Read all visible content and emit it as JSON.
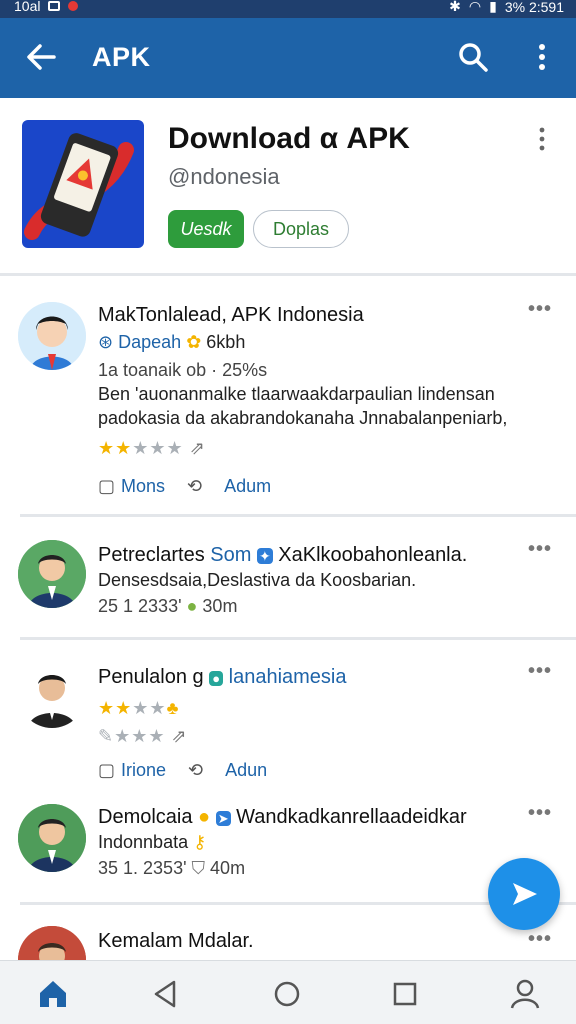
{
  "status_bar": {
    "time_left": "10al",
    "right_text": "3% 2:591"
  },
  "app_bar": {
    "title": "APK"
  },
  "header": {
    "app_title": "Download α APK",
    "app_subtitle": "@ndonesia",
    "primary_button": "Uesdk",
    "secondary_button": "Doplas"
  },
  "posts": [
    {
      "name": "MakTonlalead, APK Indonesia",
      "handle": "Dapeah",
      "handle_extra": "6kbh",
      "meta": "1a toanaik ob · 25%s",
      "text_line1": "Ben 'auonanmalke tlaarwaakdarpaulian lindensan",
      "text_line2": "padokasia da akabrandokanaha Jnnabalanpeniarb,",
      "action_more": "Mons",
      "action_add": "Adum"
    },
    {
      "name": "Petreclartes",
      "name_tag": "Som",
      "name_extra": "XaKlkoobahonleanla.",
      "text_line1": "Densesdsaia,Deslastiva da Koosbarian.",
      "meta": "25 1 2333'",
      "meta_extra": "30m"
    },
    {
      "name": "Penulalon",
      "name_tag": "g",
      "name_extra": "lanahiamesia",
      "action_more": "Irione",
      "action_add": "Adun"
    },
    {
      "name": "Demolcaia",
      "name_extra": "Wandkadkanrellaadeidkar",
      "text_line1": "Indonnbata",
      "meta": "35 1. 2353'",
      "meta_extra": "40m"
    },
    {
      "name": "Kemalam Mdalar."
    }
  ],
  "colors": {
    "app_bar": "#1e63a8",
    "status_bar": "#1f3f6e",
    "primary": "#2e9c3c",
    "fab": "#1e90e8",
    "star": "#f4b400"
  },
  "icons": [
    "back-arrow-icon",
    "search-icon",
    "more-vertical-icon",
    "more-horizontal-icon",
    "comment-icon",
    "retweet-icon",
    "send-icon",
    "home-icon",
    "nav-back-icon",
    "nav-home-circle-icon",
    "nav-recents-icon",
    "profile-icon"
  ]
}
